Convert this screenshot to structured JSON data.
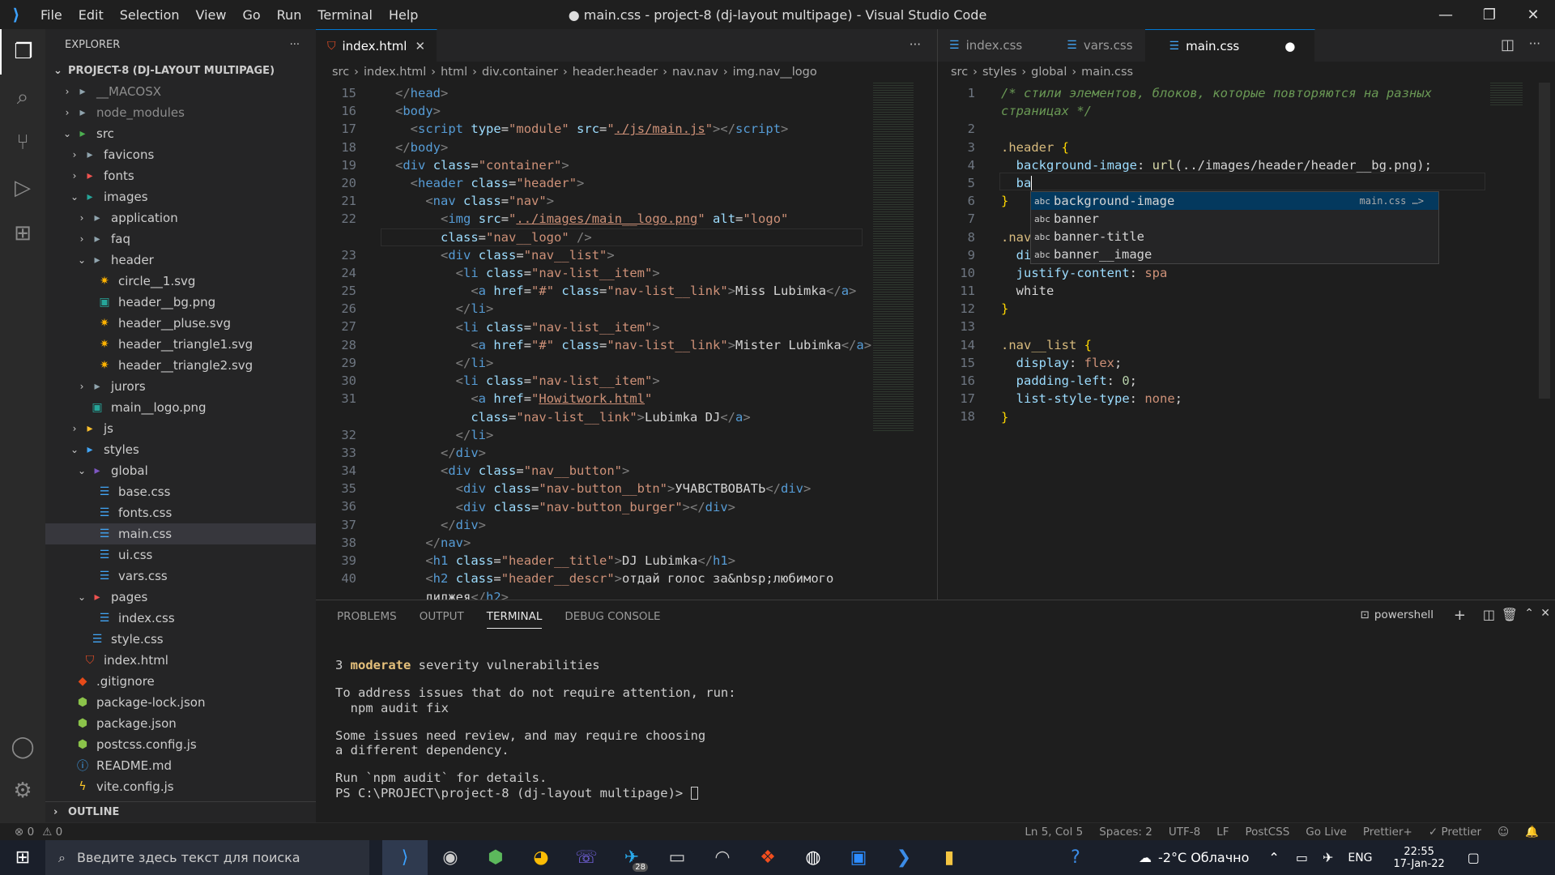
{
  "titlebar": {
    "menu": [
      "File",
      "Edit",
      "Selection",
      "View",
      "Go",
      "Run",
      "Terminal",
      "Help"
    ],
    "title": "● main.css - project-8 (dj-layout multipage) - Visual Studio Code",
    "minimize": "—",
    "maximize": "❐",
    "close": "✕"
  },
  "explorer": {
    "header": "EXPLORER",
    "more": "···",
    "project": "PROJECT-8 (DJ-LAYOUT MULTIPAGE)",
    "outline": "OUTLINE",
    "items": [
      {
        "label": "__MACOSX",
        "depth": 1,
        "kind": "folder",
        "chev": "›",
        "muted": true
      },
      {
        "label": "node_modules",
        "depth": 1,
        "kind": "folder",
        "chev": "›",
        "muted": true
      },
      {
        "label": "src",
        "depth": 1,
        "kind": "folder-src",
        "chev": "⌄"
      },
      {
        "label": "favicons",
        "depth": 2,
        "kind": "folder",
        "chev": "›"
      },
      {
        "label": "fonts",
        "depth": 2,
        "kind": "folder-red",
        "chev": "›"
      },
      {
        "label": "images",
        "depth": 2,
        "kind": "folder-img",
        "chev": "⌄"
      },
      {
        "label": "application",
        "depth": 3,
        "kind": "folder",
        "chev": "›"
      },
      {
        "label": "faq",
        "depth": 3,
        "kind": "folder",
        "chev": "›"
      },
      {
        "label": "header",
        "depth": 3,
        "kind": "folder",
        "chev": "⌄"
      },
      {
        "label": "circle__1.svg",
        "depth": 4,
        "kind": "svg",
        "chev": ""
      },
      {
        "label": "header__bg.png",
        "depth": 4,
        "kind": "png",
        "chev": ""
      },
      {
        "label": "header__pluse.svg",
        "depth": 4,
        "kind": "svg",
        "chev": ""
      },
      {
        "label": "header__triangle1.svg",
        "depth": 4,
        "kind": "svg",
        "chev": ""
      },
      {
        "label": "header__triangle2.svg",
        "depth": 4,
        "kind": "svg",
        "chev": ""
      },
      {
        "label": "jurors",
        "depth": 3,
        "kind": "folder",
        "chev": "›"
      },
      {
        "label": "main__logo.png",
        "depth": 3,
        "kind": "png",
        "chev": ""
      },
      {
        "label": "js",
        "depth": 2,
        "kind": "folder-js",
        "chev": "›"
      },
      {
        "label": "styles",
        "depth": 2,
        "kind": "folder-st",
        "chev": "⌄"
      },
      {
        "label": "global",
        "depth": 3,
        "kind": "folder-gl",
        "chev": "⌄"
      },
      {
        "label": "base.css",
        "depth": 4,
        "kind": "css",
        "chev": ""
      },
      {
        "label": "fonts.css",
        "depth": 4,
        "kind": "css",
        "chev": ""
      },
      {
        "label": "main.css",
        "depth": 4,
        "kind": "css",
        "chev": "",
        "selected": true
      },
      {
        "label": "ui.css",
        "depth": 4,
        "kind": "css",
        "chev": ""
      },
      {
        "label": "vars.css",
        "depth": 4,
        "kind": "css",
        "chev": ""
      },
      {
        "label": "pages",
        "depth": 3,
        "kind": "folder-red",
        "chev": "⌄"
      },
      {
        "label": "index.css",
        "depth": 4,
        "kind": "css",
        "chev": ""
      },
      {
        "label": "style.css",
        "depth": 3,
        "kind": "css",
        "chev": ""
      },
      {
        "label": "index.html",
        "depth": 2,
        "kind": "html",
        "chev": ""
      },
      {
        "label": ".gitignore",
        "depth": 1,
        "kind": "git",
        "chev": ""
      },
      {
        "label": "package-lock.json",
        "depth": 1,
        "kind": "json",
        "chev": ""
      },
      {
        "label": "package.json",
        "depth": 1,
        "kind": "json",
        "chev": ""
      },
      {
        "label": "postcss.config.js",
        "depth": 1,
        "kind": "js",
        "chev": ""
      },
      {
        "label": "README.md",
        "depth": 1,
        "kind": "md",
        "chev": ""
      },
      {
        "label": "vite.config.js",
        "depth": 1,
        "kind": "vite",
        "chev": ""
      }
    ]
  },
  "left_editor": {
    "tab": "index.html",
    "tab_close": "✕",
    "more": "···",
    "breadcrumb": [
      "src",
      "index.html",
      "html",
      "div.container",
      "header.header",
      "nav.nav",
      "img.nav__logo"
    ],
    "line_numbers": [
      "15",
      "16",
      "17",
      "18",
      "19",
      "20",
      "21",
      "22",
      "",
      "23",
      "24",
      "25",
      "26",
      "27",
      "28",
      "29",
      "30",
      "31",
      "",
      "32",
      "33",
      "34",
      "35",
      "36",
      "37",
      "38",
      "39",
      "40",
      ""
    ]
  },
  "right_editor": {
    "tabs": [
      "index.css",
      "vars.css",
      "main.css"
    ],
    "dirty": "●",
    "breadcrumb": [
      "src",
      "styles",
      "global",
      "main.css"
    ],
    "line_numbers": [
      "1",
      "",
      "2",
      "3",
      "4",
      "5",
      "6",
      "7",
      "8",
      "9",
      "10",
      "11",
      "12",
      "13",
      "14",
      "15",
      "16",
      "17",
      "18"
    ],
    "suggest": [
      {
        "label": "background-image",
        "detail": "main.css …>"
      },
      {
        "label": "banner",
        "detail": ""
      },
      {
        "label": "banner-title",
        "detail": ""
      },
      {
        "label": "banner__image",
        "detail": ""
      }
    ],
    "suggest_kind": "abc"
  },
  "panel": {
    "tabs": [
      "PROBLEMS",
      "OUTPUT",
      "TERMINAL",
      "DEBUG CONSOLE"
    ],
    "shell": "powershell",
    "terminal": [
      "",
      "3 moderate severity vulnerabilities",
      "",
      "To address issues that do not require attention, run:",
      "  npm audit fix",
      "",
      "Some issues need review, and may require choosing",
      "a different dependency.",
      "",
      "Run `npm audit` for details.",
      "PS C:\\PROJECT\\project-8 (dj-layout multipage)> "
    ]
  },
  "statusbar": {
    "errors": "⊗ 0",
    "warnings": "⚠ 0",
    "pos": "Ln 5, Col 5",
    "spaces": "Spaces: 2",
    "enc": "UTF-8",
    "eol": "LF",
    "lang": "PostCSS",
    "golive": "Go Live",
    "prettier_plus": "Prettier+",
    "prettier": "✓ Prettier"
  },
  "taskbar": {
    "search_placeholder": "Введите здесь текст для поиска",
    "weather": "-2°C Облачно",
    "lang": "ENG",
    "time": "22:55",
    "date": "17-Jan-22",
    "badge": "28"
  },
  "colors": {
    "accent": "#0078d4",
    "bg": "#1e1e1e",
    "sidebar": "#252526"
  }
}
